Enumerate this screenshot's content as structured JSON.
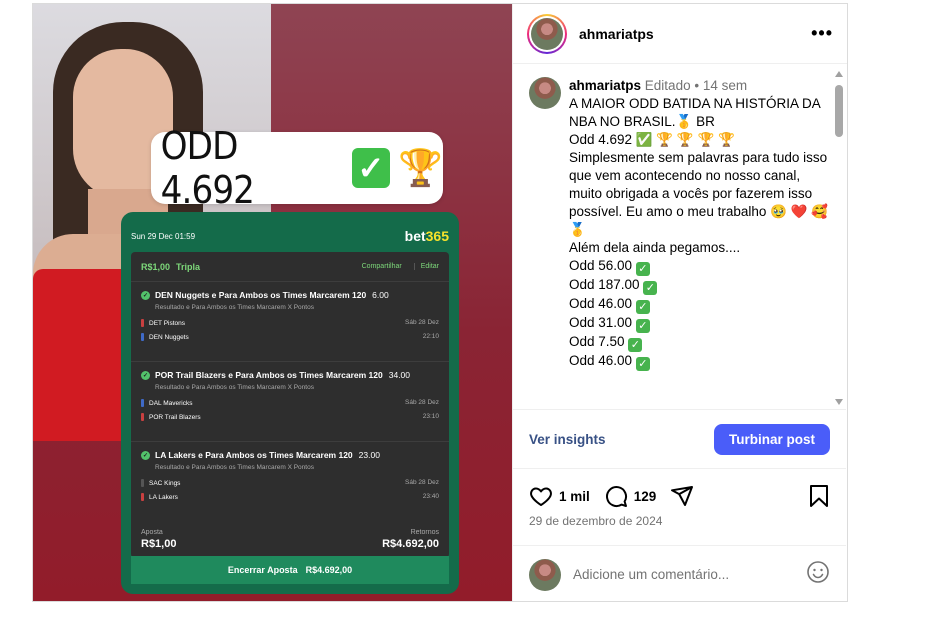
{
  "post": {
    "username": "ahmariatps",
    "edited_label": "Editado",
    "time_ago": "14 sem",
    "caption_lines": [
      "A MAIOR ODD BATIDA NA HISTÓRIA DA NBA NO BRASIL.🥇 BR",
      "",
      "Odd 4.692 ✅ 🏆 🏆 🏆 🏆",
      "Simplesmente sem palavras para tudo isso que vem acontecendo no nosso canal, muito obrigada a vocês por fazerem isso possível. Eu amo o meu trabalho 🥹 ❤️ 🥰 🥇",
      "",
      "Além dela ainda pegamos....",
      ""
    ],
    "odds_list": [
      "Odd 56.00",
      "Odd 187.00",
      "Odd 46.00",
      "Odd 31.00",
      "Odd 7.50",
      "Odd 46.00"
    ],
    "insights_label": "Ver insights",
    "boost_label": "Turbinar post",
    "likes": "1 mil",
    "comments": "129",
    "date": "29 de dezembro de 2024",
    "comment_placeholder": "Adicione um comentário..."
  },
  "media": {
    "banner_text": "ODD 4.692",
    "bet": {
      "datetime": "Sun 29 Dec 01:59",
      "bookmaker": "bet365",
      "stake": "R$1,00",
      "type": "Tripla",
      "share_label": "Compartilhar",
      "edit_label": "Editar",
      "legs": [
        {
          "title": "DEN Nuggets e Para Ambos os Times Marcarem 120",
          "odds": "6.00",
          "market": "Resultado e Para Ambos os Times Marcarem X Pontos",
          "team1": "DET Pistons",
          "date": "Sáb 28 Dez",
          "team2": "DEN Nuggets",
          "time": "22:10"
        },
        {
          "title": "POR Trail Blazers e Para Ambos os Times Marcarem 120",
          "odds": "34.00",
          "market": "Resultado e Para Ambos os Times Marcarem X Pontos",
          "team1": "DAL Mavericks",
          "date": "Sáb 28 Dez",
          "team2": "POR Trail Blazers",
          "time": "23:10"
        },
        {
          "title": "LA Lakers e Para Ambos os Times Marcarem 120",
          "odds": "23.00",
          "market": "Resultado e Para Ambos os Times Marcarem X Pontos",
          "team1": "SAC Kings",
          "date": "Sáb 28 Dez",
          "team2": "LA Lakers",
          "time": "23:40"
        }
      ],
      "stake_label": "Aposta",
      "stake_value": "R$1,00",
      "returns_label": "Retornos",
      "returns_value": "R$4.692,00",
      "cashout_label": "Encerrar Aposta",
      "cashout_value": "R$4.692,00"
    }
  },
  "colors": {
    "accent": "#4a5df9",
    "link": "#385185",
    "bet365_green": "#146b4a"
  }
}
